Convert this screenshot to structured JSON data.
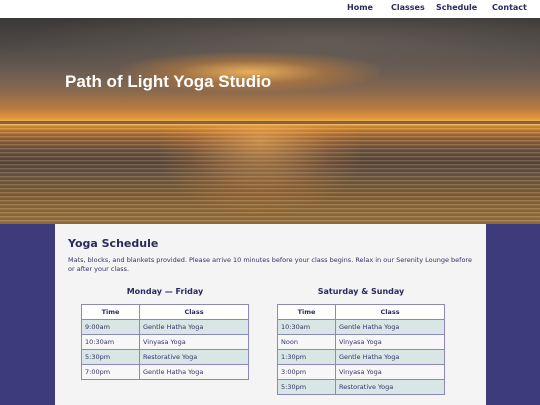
{
  "nav": {
    "home": "Home",
    "classes": "Classes",
    "schedule": "Schedule",
    "contact": "Contact"
  },
  "hero": {
    "title": "Path of Light Yoga Studio"
  },
  "content": {
    "heading": "Yoga Schedule",
    "intro": "Mats, blocks, and blankets provided. Please arrive 10 minutes before your class begins. Relax in our Serenity Lounge before or after your class."
  },
  "weekday": {
    "title": "Monday — Friday",
    "col_time": "Time",
    "col_class": "Class",
    "rows": [
      {
        "time": "9:00am",
        "class": "Gentle Hatha Yoga"
      },
      {
        "time": "10:30am",
        "class": "Vinyasa Yoga"
      },
      {
        "time": "5:30pm",
        "class": "Restorative Yoga"
      },
      {
        "time": "7:00pm",
        "class": "Gentle Hatha Yoga"
      }
    ]
  },
  "weekend": {
    "title": "Saturday & Sunday",
    "col_time": "Time",
    "col_class": "Class",
    "rows": [
      {
        "time": "10:30am",
        "class": "Gentle Hatha Yoga"
      },
      {
        "time": "Noon",
        "class": "Vinyasa Yoga"
      },
      {
        "time": "1:30pm",
        "class": "Gentle Hatha Yoga"
      },
      {
        "time": "3:00pm",
        "class": "Vinyasa Yoga"
      },
      {
        "time": "5:30pm",
        "class": "Restorative Yoga"
      }
    ]
  },
  "colors": {
    "accent": "#2b2a5e",
    "page_bg": "#3d3b7a",
    "row_alt": "#d8e6e6",
    "border": "#8a89b8"
  }
}
